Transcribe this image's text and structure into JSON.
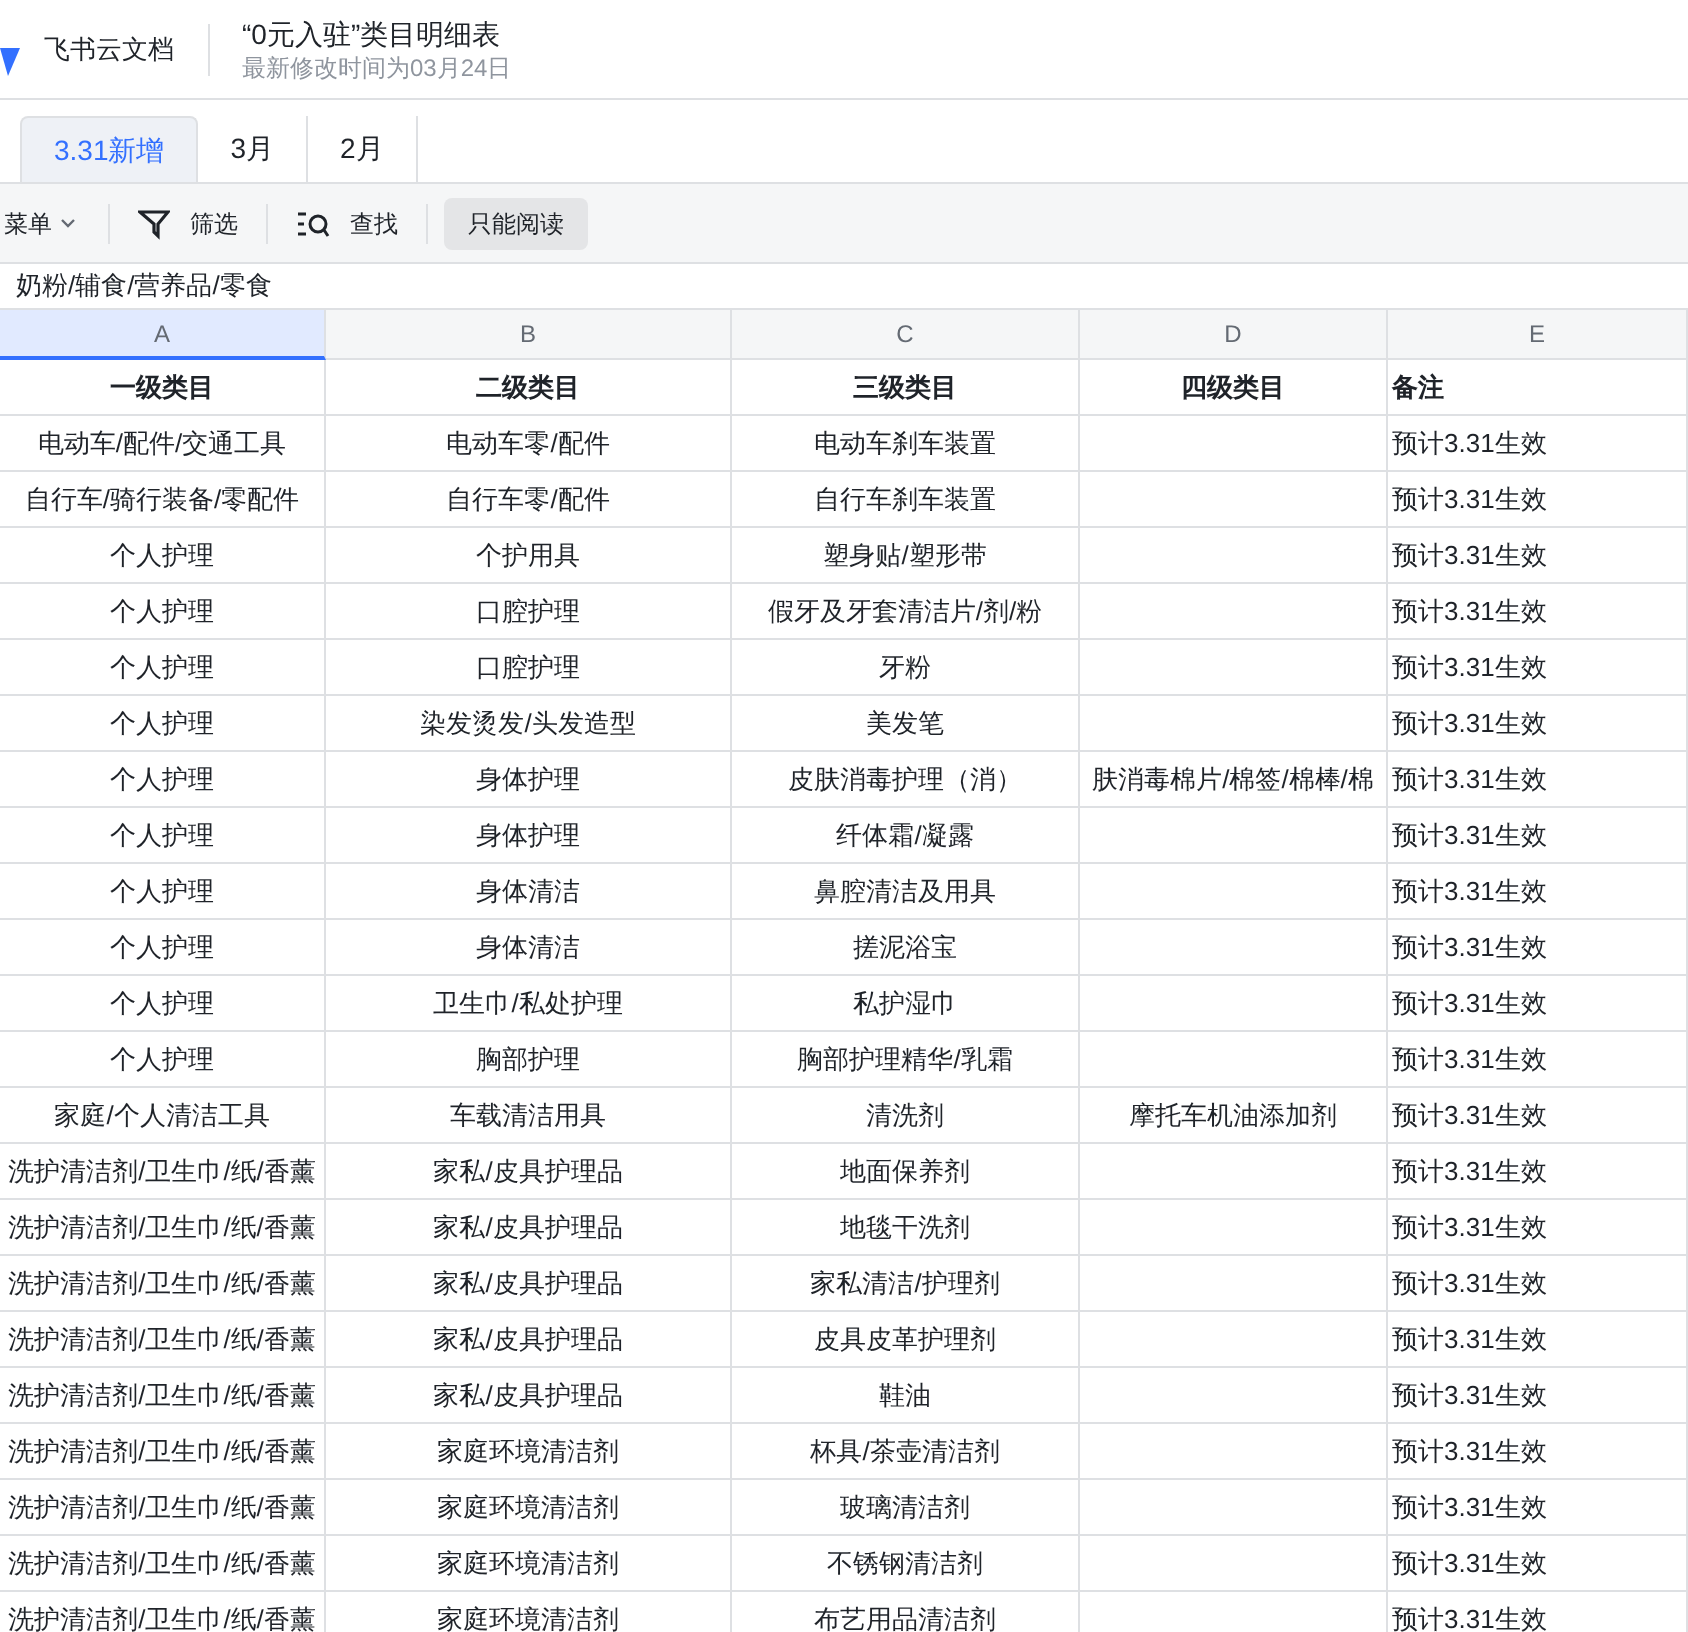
{
  "app": {
    "name": "飞书云文档"
  },
  "document": {
    "title": "“0元入驻”类目明细表",
    "modified": "最新修改时间为03月24日"
  },
  "tabs": [
    {
      "label": "3.31新增",
      "selected": true
    },
    {
      "label": "3月",
      "selected": false
    },
    {
      "label": "2月",
      "selected": false
    }
  ],
  "toolbar": {
    "menu": "菜单",
    "filter": "筛选",
    "find": "查找",
    "mode": "只能阅读"
  },
  "formula_bar": {
    "value": "奶粉/辅食/营养品/零食"
  },
  "table": {
    "columns": [
      {
        "letter": "A",
        "selected": true
      },
      {
        "letter": "B",
        "selected": false
      },
      {
        "letter": "C",
        "selected": false
      },
      {
        "letter": "D",
        "selected": false
      },
      {
        "letter": "E",
        "selected": false
      }
    ],
    "header_row": [
      "一级类目",
      "二级类目",
      "三级类目",
      "四级类目",
      "备注"
    ],
    "rows": [
      {
        "level_1": "电动车/配件/交通工具",
        "level_2": "电动车零/配件",
        "level_3": "电动车刹车装置",
        "note": "预计3.31生效"
      },
      {
        "level_1": "自行车/骑行装备/零配件",
        "level_2": "自行车零/配件",
        "level_3": "自行车刹车装置",
        "note": "预计3.31生效"
      },
      {
        "level_1": "个人护理",
        "level_2": "个护用具",
        "level_3": "塑身贴/塑形带",
        "note": "预计3.31生效"
      },
      {
        "level_1": "个人护理",
        "level_2": "口腔护理",
        "level_3": "假牙及牙套清洁片/剂/粉",
        "note": "预计3.31生效"
      },
      {
        "level_1": "个人护理",
        "level_2": "口腔护理",
        "level_3": "牙粉",
        "note": "预计3.31生效"
      },
      {
        "level_1": "个人护理",
        "level_2": "染发烫发/头发造型",
        "level_3": "美发笔",
        "note": "预计3.31生效"
      },
      {
        "level_1": "个人护理",
        "level_2": "身体护理",
        "level_3": "皮肤消毒护理（消）",
        "level_4": "肤消毒棉片/棉签/棉棒/棉",
        "note": "预计3.31生效"
      },
      {
        "level_1": "个人护理",
        "level_2": "身体护理",
        "level_3": "纤体霜/凝露",
        "note": "预计3.31生效"
      },
      {
        "level_1": "个人护理",
        "level_2": "身体清洁",
        "level_3": "鼻腔清洁及用具",
        "note": "预计3.31生效"
      },
      {
        "level_1": "个人护理",
        "level_2": "身体清洁",
        "level_3": "搓泥浴宝",
        "note": "预计3.31生效"
      },
      {
        "level_1": "个人护理",
        "level_2": "卫生巾/私处护理",
        "level_3": "私护湿巾",
        "note": "预计3.31生效"
      },
      {
        "level_1": "个人护理",
        "level_2": "胸部护理",
        "level_3": "胸部护理精华/乳霜",
        "note": "预计3.31生效"
      },
      {
        "level_1": "家庭/个人清洁工具",
        "level_2": "车载清洁用具",
        "level_3": "清洗剂",
        "level_4": "摩托车机油添加剂",
        "note": "预计3.31生效"
      },
      {
        "level_1": "洗护清洁剂/卫生巾/纸/香薰",
        "level_2": "家私/皮具护理品",
        "level_3": "地面保养剂",
        "note": "预计3.31生效"
      },
      {
        "level_1": "洗护清洁剂/卫生巾/纸/香薰",
        "level_2": "家私/皮具护理品",
        "level_3": "地毯干洗剂",
        "note": "预计3.31生效"
      },
      {
        "level_1": "洗护清洁剂/卫生巾/纸/香薰",
        "level_2": "家私/皮具护理品",
        "level_3": "家私清洁/护理剂",
        "note": "预计3.31生效"
      },
      {
        "level_1": "洗护清洁剂/卫生巾/纸/香薰",
        "level_2": "家私/皮具护理品",
        "level_3": "皮具皮革护理剂",
        "note": "预计3.31生效"
      },
      {
        "level_1": "洗护清洁剂/卫生巾/纸/香薰",
        "level_2": "家私/皮具护理品",
        "level_3": "鞋油",
        "note": "预计3.31生效"
      },
      {
        "level_1": "洗护清洁剂/卫生巾/纸/香薰",
        "level_2": "家庭环境清洁剂",
        "level_3": "杯具/茶壶清洁剂",
        "note": "预计3.31生效"
      },
      {
        "level_1": "洗护清洁剂/卫生巾/纸/香薰",
        "level_2": "家庭环境清洁剂",
        "level_3": "玻璃清洁剂",
        "note": "预计3.31生效"
      },
      {
        "level_1": "洗护清洁剂/卫生巾/纸/香薰",
        "level_2": "家庭环境清洁剂",
        "level_3": "不锈钢清洁剂",
        "note": "预计3.31生效"
      },
      {
        "level_1": "洗护清洁剂/卫生巾/纸/香薰",
        "level_2": "家庭环境清洁剂",
        "level_3": "布艺用品清洁剂",
        "note": "预计3.31生效"
      }
    ]
  }
}
